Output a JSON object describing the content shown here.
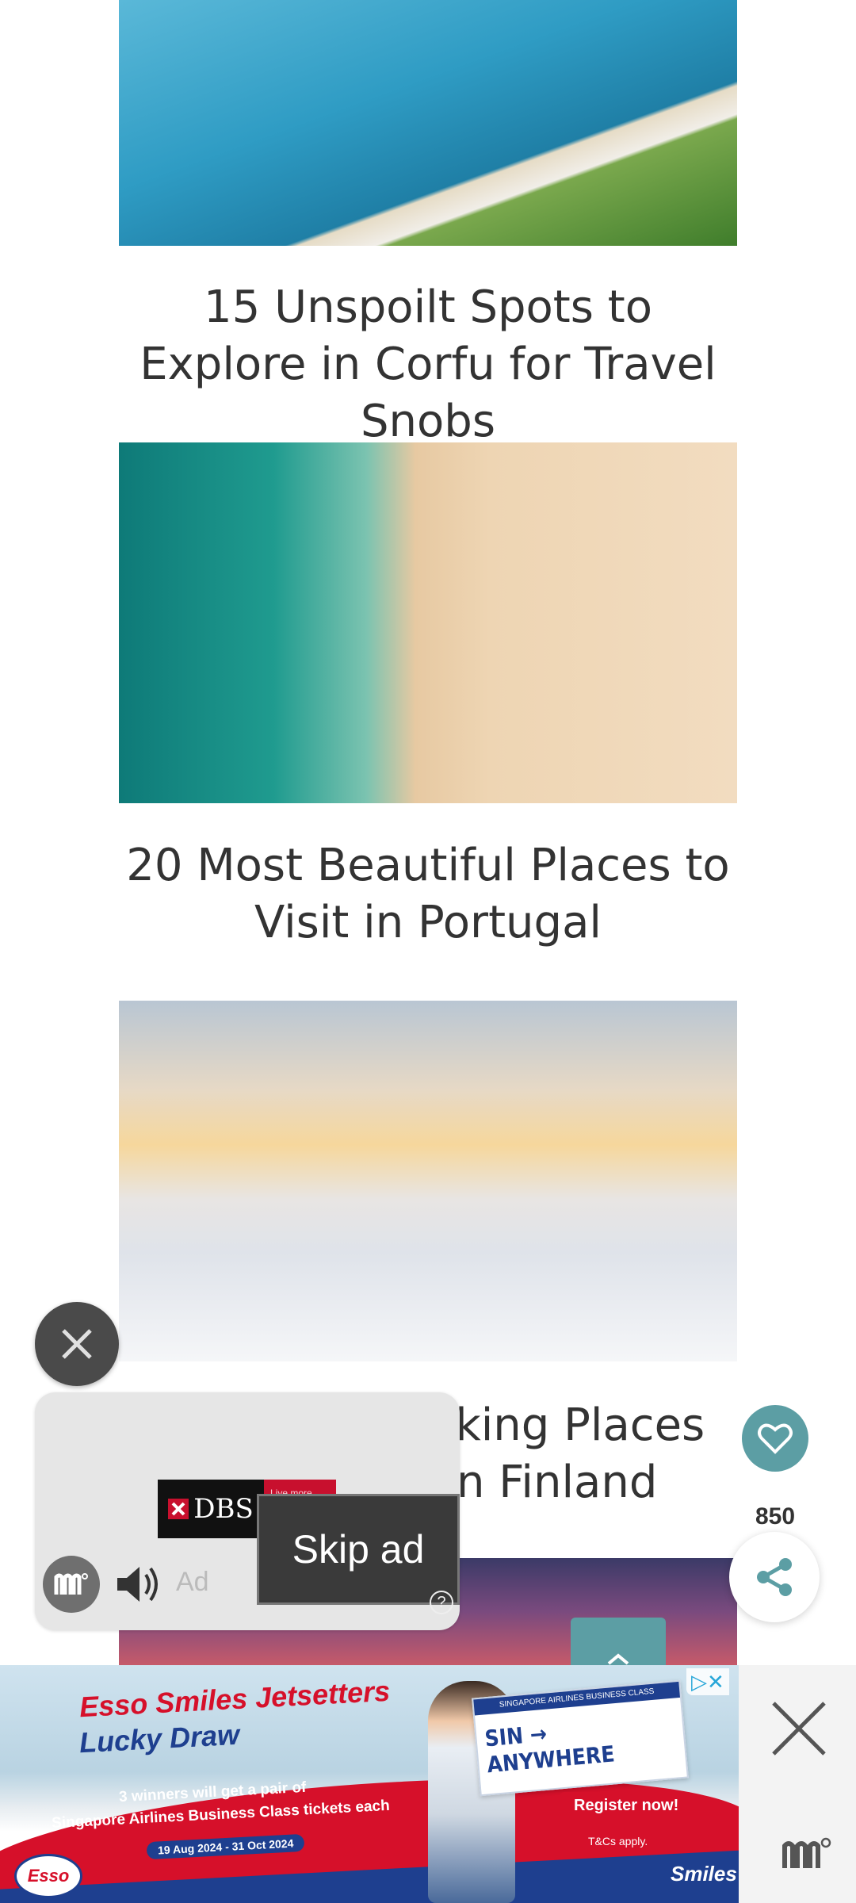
{
  "articles": [
    {
      "title": "15 Unspoilt Spots to Explore in Corfu for Travel Snobs"
    },
    {
      "title": "20 Most Beautiful Places to Visit in Portugal"
    },
    {
      "title_visible_fragment_line1": "aking Places",
      "title_visible_fragment_line2": "n Finland"
    }
  ],
  "video_ad": {
    "brand": "DBS",
    "brand_tagline": "Live more, Bank less",
    "skip_label": "Skip ad",
    "ad_label": "Ad",
    "help_symbol": "?"
  },
  "floating_actions": {
    "share_count": "850"
  },
  "banner_ad": {
    "title": "Esso Smiles Jetsetters",
    "subtitle": "Lucky Draw",
    "description_line1": "3 winners will get a pair of",
    "description_line2": "Singapore Airlines Business Class tickets each",
    "dates": "19 Aug 2024 - 31 Oct 2024",
    "pass_header": "SINGAPORE AIRLINES BUSINESS CLASS",
    "pass_route": "SIN → ANYWHERE",
    "cta_label": "Register now!",
    "terms": "T&Cs apply.",
    "esso_logo": "Esso",
    "smiles_logo": "Smiles",
    "adchoices_symbol": "▷✕"
  },
  "colors": {
    "accent_teal": "#5c9ea4",
    "esso_red": "#d6102a",
    "esso_blue": "#1e3f8f"
  }
}
